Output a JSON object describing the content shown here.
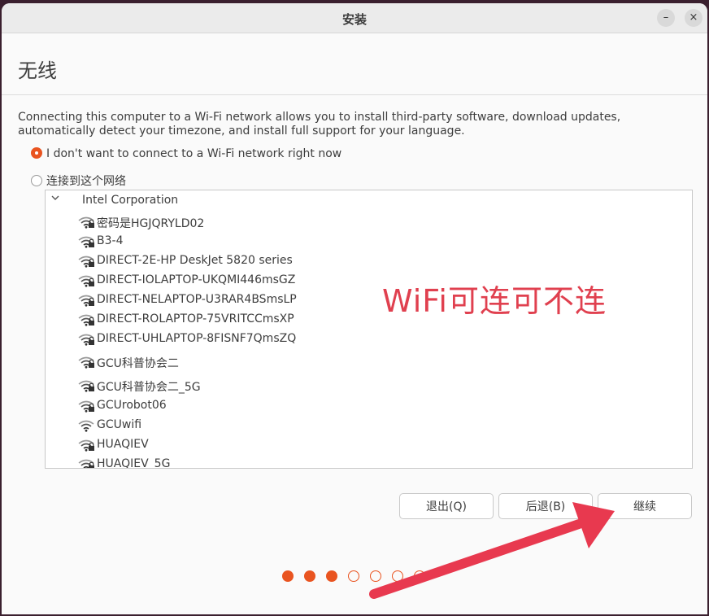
{
  "window": {
    "title": "安装",
    "minimize_glyph": "–",
    "close_glyph": "×"
  },
  "page": {
    "title": "无线",
    "description": "Connecting this computer to a Wi-Fi network allows you to install third-party software, download updates, automatically detect your timezone, and install full support for your language."
  },
  "options": {
    "no_wifi": {
      "label": "I don't want to connect to a Wi-Fi network right now",
      "selected": true
    },
    "connect": {
      "label": "连接到这个网络",
      "selected": false
    }
  },
  "networks": {
    "group_label": "Intel Corporation",
    "items": [
      {
        "name": "密码是HGJQRYLD02",
        "secured": true
      },
      {
        "name": "B3-4",
        "secured": true
      },
      {
        "name": "DIRECT-2E-HP DeskJet 5820 series",
        "secured": true
      },
      {
        "name": "DIRECT-IOLAPTOP-UKQMI446msGZ",
        "secured": true
      },
      {
        "name": "DIRECT-NELAPTOP-U3RAR4BSmsLP",
        "secured": true
      },
      {
        "name": "DIRECT-ROLAPTOP-75VRITCCmsXP",
        "secured": true
      },
      {
        "name": "DIRECT-UHLAPTOP-8FISNF7QmsZQ",
        "secured": true
      },
      {
        "name": "GCU科普协会二",
        "secured": true
      },
      {
        "name": "GCU科普协会二_5G",
        "secured": true
      },
      {
        "name": "GCUrobot06",
        "secured": true
      },
      {
        "name": "GCUwifi",
        "secured": false
      },
      {
        "name": "HUAQIEV",
        "secured": true
      },
      {
        "name": "HUAQIEV_5G",
        "secured": true
      }
    ]
  },
  "buttons": {
    "quit": "退出(Q)",
    "back": "后退(B)",
    "continue": "继续"
  },
  "progress": {
    "total_steps": 7,
    "completed_steps": 3
  },
  "annotation": {
    "text": "WiFi可连可不连",
    "color": "#e0404f"
  },
  "colors": {
    "accent": "#e95420",
    "annotation": "#e0404f"
  }
}
